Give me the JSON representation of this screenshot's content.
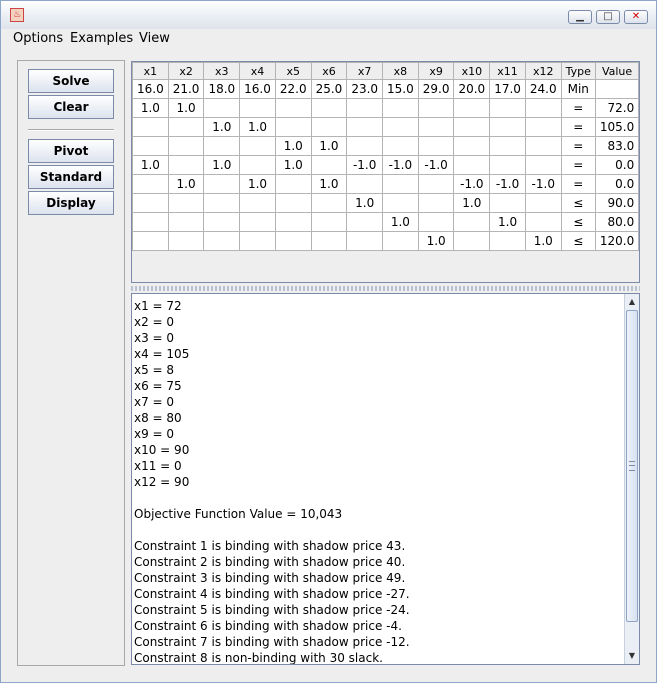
{
  "window": {
    "icon": "java-cup-icon",
    "buttons": [
      "minimize-icon",
      "maximize-icon",
      "close-icon"
    ]
  },
  "menubar": {
    "items": [
      "Options",
      "Examples",
      "View"
    ]
  },
  "actions": {
    "group1": [
      "Solve",
      "Clear"
    ],
    "group2": [
      "Pivot",
      "Standard",
      "Display"
    ]
  },
  "table": {
    "headers": [
      "x1",
      "x2",
      "x3",
      "x4",
      "x5",
      "x6",
      "x7",
      "x8",
      "x9",
      "x10",
      "x11",
      "x12",
      "Type",
      "Value"
    ],
    "objective": [
      "16.0",
      "21.0",
      "18.0",
      "16.0",
      "22.0",
      "25.0",
      "23.0",
      "15.0",
      "29.0",
      "20.0",
      "17.0",
      "24.0",
      "Min",
      ""
    ],
    "constraints": [
      [
        "1.0",
        "1.0",
        "",
        "",
        "",
        "",
        "",
        "",
        "",
        "",
        "",
        "",
        "=",
        "72.0"
      ],
      [
        "",
        "",
        "1.0",
        "1.0",
        "",
        "",
        "",
        "",
        "",
        "",
        "",
        "",
        "=",
        "105.0"
      ],
      [
        "",
        "",
        "",
        "",
        "1.0",
        "1.0",
        "",
        "",
        "",
        "",
        "",
        "",
        "=",
        "83.0"
      ],
      [
        "1.0",
        "",
        "1.0",
        "",
        "1.0",
        "",
        "-1.0",
        "-1.0",
        "-1.0",
        "",
        "",
        "",
        "=",
        "0.0"
      ],
      [
        "",
        "1.0",
        "",
        "1.0",
        "",
        "1.0",
        "",
        "",
        "",
        "-1.0",
        "-1.0",
        "-1.0",
        "=",
        "0.0"
      ],
      [
        "",
        "",
        "",
        "",
        "",
        "",
        "1.0",
        "",
        "",
        "1.0",
        "",
        "",
        "≤",
        "90.0"
      ],
      [
        "",
        "",
        "",
        "",
        "",
        "",
        "",
        "1.0",
        "",
        "",
        "1.0",
        "",
        "≤",
        "80.0"
      ],
      [
        "",
        "",
        "",
        "",
        "",
        "",
        "",
        "",
        "1.0",
        "",
        "",
        "1.0",
        "≤",
        "120.0"
      ]
    ]
  },
  "output": {
    "lines": [
      "x1 = 72",
      "x2 = 0",
      "x3 = 0",
      "x4 = 105",
      "x5 = 8",
      "x6 = 75",
      "x7 = 0",
      "x8 = 80",
      "x9 = 0",
      "x10 = 90",
      "x11 = 0",
      "x12 = 90",
      "",
      "Objective Function Value = 10,043",
      "",
      "Constraint 1 is binding with shadow price 43.",
      "Constraint 2 is binding with shadow price 40.",
      "Constraint 3 is binding with shadow price 49.",
      "Constraint 4 is binding with shadow price -27.",
      "Constraint 5 is binding with shadow price -24.",
      "Constraint 6 is binding with shadow price -4.",
      "Constraint 7 is binding with shadow price -12.",
      "Constraint 8 is non-binding with 30 slack."
    ]
  }
}
